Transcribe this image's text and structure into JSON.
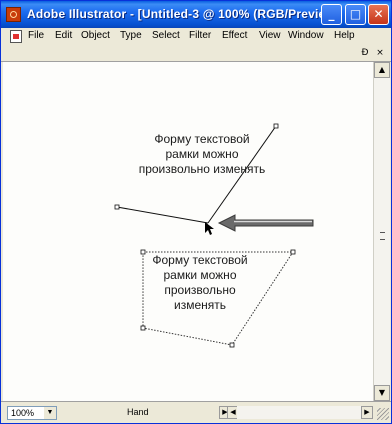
{
  "window": {
    "title": "Adobe Illustrator - [Untitled-3 @ 100% (RGB/Previe…",
    "buttons": {
      "minimize": "_",
      "maximize": "□",
      "close": "✕"
    }
  },
  "menubar": {
    "items": [
      "File",
      "Edit",
      "Object",
      "Type",
      "Select",
      "Filter",
      "Effect",
      "View",
      "Window",
      "Help"
    ]
  },
  "doc_controls": {
    "restore": "Ɖ",
    "close": "×"
  },
  "canvas": {
    "upper_text": [
      "Форму текстовой",
      "рамки можно",
      "произвольно изменять"
    ],
    "lower_text": [
      "Форму текстовой",
      "рамки можно",
      "произвольно",
      "изменять"
    ]
  },
  "status": {
    "zoom": "100%",
    "tool": "Hand"
  },
  "icons": {
    "app": "adobe-illustrator-icon",
    "document": "document-icon",
    "cursor": "direct-selection-cursor-icon",
    "pointer_arrow": "left-arrow-icon"
  }
}
